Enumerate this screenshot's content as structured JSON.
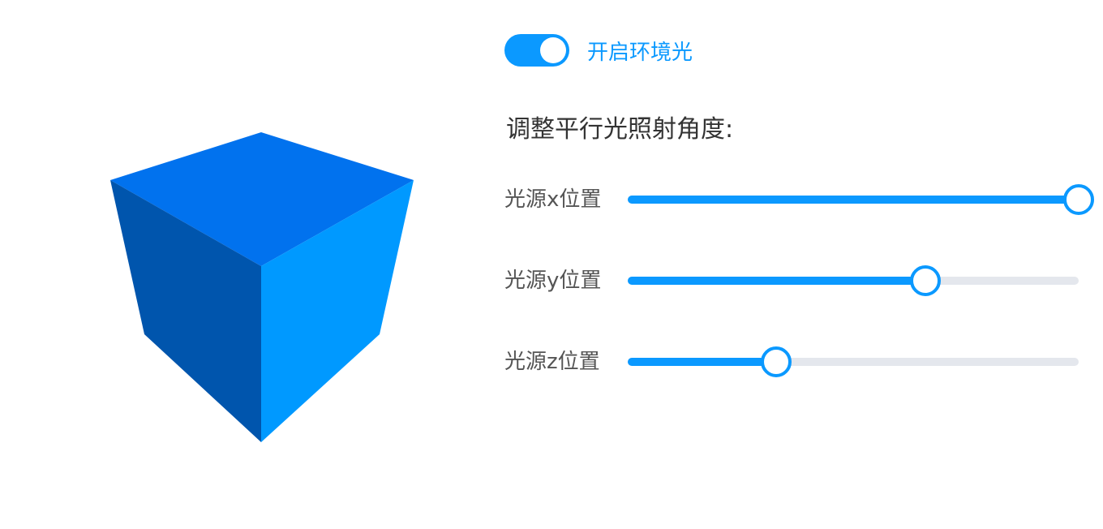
{
  "ambient_light": {
    "enabled": true,
    "label": "开启环境光"
  },
  "directional_light": {
    "title": "调整平行光照射角度:",
    "sliders": [
      {
        "label": "光源x位置",
        "value_fraction": 1.0
      },
      {
        "label": "光源y位置",
        "value_fraction": 0.66
      },
      {
        "label": "光源z位置",
        "value_fraction": 0.33
      }
    ]
  },
  "cube": {
    "top_color": "#0172ee",
    "left_color": "#0055ad",
    "right_color": "#0099ff"
  },
  "theme": {
    "accent": "#0b99ff",
    "track": "#e4e7ed"
  }
}
